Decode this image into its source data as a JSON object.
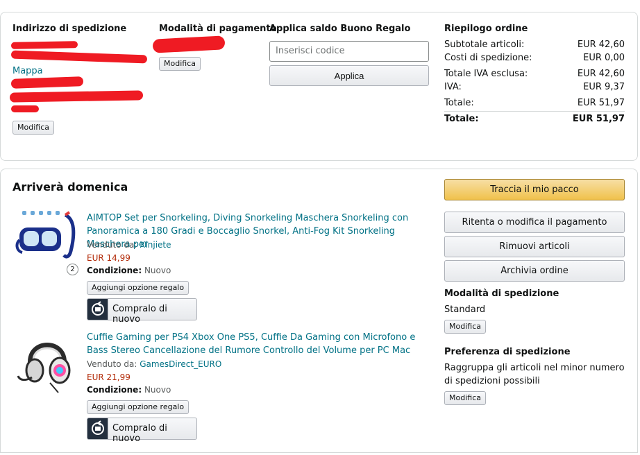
{
  "shipping": {
    "heading": "Indirizzo di spedizione",
    "map_link": "Mappa",
    "edit_label": "Modifica"
  },
  "payment": {
    "heading": "Modalità di pagamento",
    "edit_label": "Modifica"
  },
  "gift": {
    "heading": "Applica saldo Buono Regalo",
    "placeholder": "Inserisci codice",
    "apply_label": "Applica"
  },
  "summary": {
    "heading": "Riepilogo ordine",
    "rows": [
      {
        "label": "Subtotale articoli:",
        "value": "EUR 42,60"
      },
      {
        "label": "Costi di spedizione:",
        "value": "EUR 0,00"
      },
      {
        "label": "Totale IVA esclusa:",
        "value": "EUR 42,60"
      },
      {
        "label": "IVA:",
        "value": "EUR 9,37"
      },
      {
        "label": "Totale:",
        "value": "EUR 51,97"
      },
      {
        "label": "Totale:",
        "value": "EUR 51,97"
      }
    ]
  },
  "shipment": {
    "arrival": "Arriverà domenica",
    "items": [
      {
        "title": "AIMTOP Set per Snorkeling, Diving Snorkeling Maschera Snorkeling con Panoramica a 180 Gradi e Boccaglio Snorkel, Anti-Fog Kit Snorkeling Maschera per",
        "sold_by_label": "Venduto da:",
        "seller": "Xinjiete",
        "price": "EUR 14,99",
        "condition_label": "Condizione:",
        "condition": "Nuovo",
        "quantity": "2",
        "gift_label": "Aggiungi opzione regalo",
        "buy_again_label": "Compralo di nuovo"
      },
      {
        "title": "Cuffie Gaming per PS4 Xbox One PS5, Cuffie Da Gaming con Microfono e Bass Stereo Cancellazione del Rumore Controllo del Volume per PC Mac",
        "sold_by_label": "Venduto da:",
        "seller": "GamesDirect_EURO",
        "price": "EUR 21,99",
        "condition_label": "Condizione:",
        "condition": "Nuovo",
        "gift_label": "Aggiungi opzione regalo",
        "buy_again_label": "Compralo di nuovo"
      }
    ]
  },
  "actions": {
    "track": "Traccia il mio pacco",
    "retry_payment": "Ritenta o modifica il pagamento",
    "remove": "Rimuovi articoli",
    "archive": "Archivia ordine"
  },
  "shipping_method": {
    "heading": "Modalità di spedizione",
    "value": "Standard",
    "edit_label": "Modifica"
  },
  "shipping_pref": {
    "heading": "Preferenza di spedizione",
    "value": "Raggruppa gli articoli nel minor numero di spedizioni possibili",
    "edit_label": "Modifica"
  },
  "colors": {
    "link": "#007185",
    "price": "#b12704",
    "track_button": "#f0c14b",
    "redaction": "#ef1b23"
  }
}
